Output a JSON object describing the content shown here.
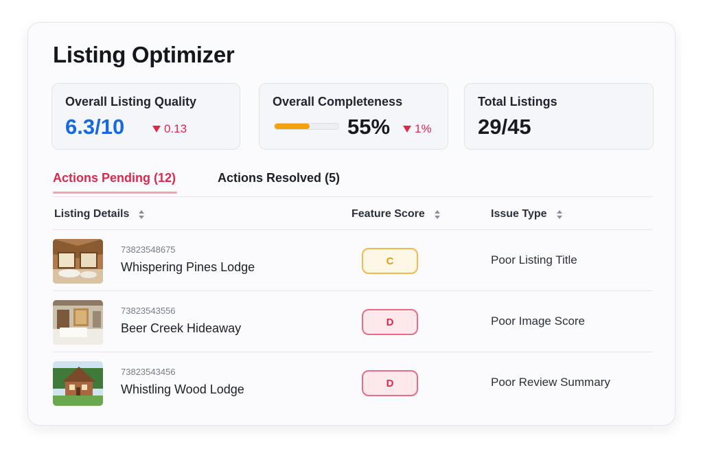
{
  "app": {
    "title": "Listing Optimizer"
  },
  "stats": {
    "quality": {
      "label": "Overall Listing Quality",
      "value": "6.3/10",
      "delta": "0.13",
      "delta_direction": "down"
    },
    "completeness": {
      "label": "Overall Completeness",
      "value": "55%",
      "progress_fraction": 0.55,
      "delta": "1%",
      "delta_direction": "down"
    },
    "total": {
      "label": "Total Listings",
      "value": "29/45"
    }
  },
  "tabs": [
    {
      "label": "Actions Pending (12)",
      "active": true
    },
    {
      "label": "Actions Resolved (5)",
      "active": false
    }
  ],
  "table": {
    "columns": [
      {
        "label": "Listing Details",
        "sort_icon": "sort-icon"
      },
      {
        "label": "Feature Score",
        "sort_icon": "sort-icon"
      },
      {
        "label": "Issue Type",
        "sort_icon": "sort-icon"
      }
    ],
    "rows": [
      {
        "id": "73823548675",
        "name": "Whispering Pines Lodge",
        "score": "C",
        "issue": "Poor Listing Title",
        "thumb_icon": "lodge-interior-photo"
      },
      {
        "id": "73823543556",
        "name": "Beer Creek Hideaway",
        "score": "D",
        "issue": "Poor Image Score",
        "thumb_icon": "bedroom-photo"
      },
      {
        "id": "73823543456",
        "name": "Whistling Wood Lodge",
        "score": "D",
        "issue": "Poor Review Summary",
        "thumb_icon": "house-exterior-photo"
      }
    ]
  },
  "colors": {
    "accent_blue": "#1769e0",
    "alert_red": "#e0264b",
    "progress_orange": "#f2a20c",
    "score_c": "#f2b84a",
    "score_d": "#ea6b84"
  }
}
